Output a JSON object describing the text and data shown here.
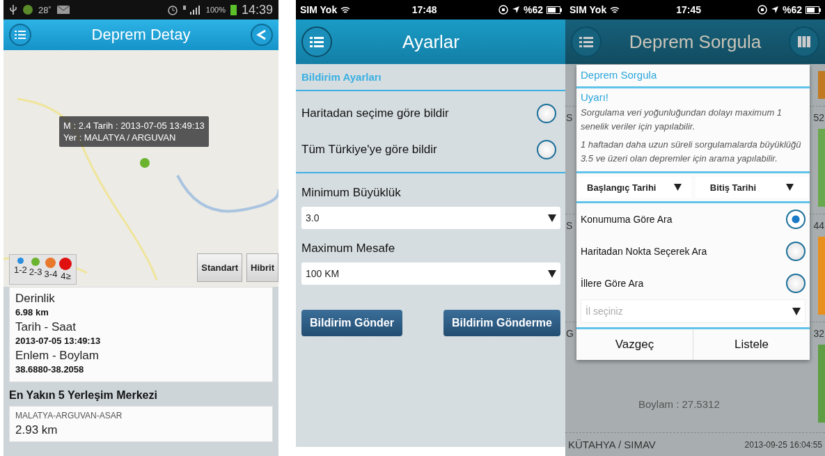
{
  "detail_screen": {
    "status_bar": {
      "temperature": "28˚",
      "battery": "100%",
      "time": "14:39"
    },
    "title": "Deprem Detay",
    "map": {
      "popup_lines": [
        "M : 2.4  Tarih : 2013-07-05 13:49:13",
        "Yer : MALATYA  / ARGUVAN"
      ],
      "legend": [
        {
          "label": "1-2",
          "color": "#2a8fe0"
        },
        {
          "label": "2-3",
          "color": "#6ab32e"
        },
        {
          "label": "3-4",
          "color": "#e8782a"
        },
        {
          "label": "4≥",
          "color": "#e01010"
        }
      ],
      "map_types": [
        "Standart",
        "Hibrit"
      ]
    },
    "details": [
      {
        "label": "Derinlik",
        "value": "6.98 km"
      },
      {
        "label": "Tarih - Saat",
        "value": "2013-07-05 13:49:13"
      },
      {
        "label": "Enlem - Boylam",
        "value": "38.6880-38.2058"
      }
    ],
    "nearest_title": "En Yakın 5 Yerleşim Merkezi",
    "nearest": [
      {
        "name": "MALATYA-ARGUVAN-ASAR",
        "distance": "2.93 km"
      }
    ]
  },
  "settings_screen": {
    "status_bar": {
      "carrier": "SIM Yok",
      "time": "17:48",
      "battery": "%62"
    },
    "title": "Ayarlar",
    "section": "Bildirim Ayarları",
    "options": [
      {
        "label": "Haritadan seçime göre bildir",
        "selected": false
      },
      {
        "label": "Tüm Türkiye'ye göre bildir",
        "selected": false
      }
    ],
    "fields": [
      {
        "label": "Minimum Büyüklük",
        "value": "3.0"
      },
      {
        "label": "Maximum Mesafe",
        "value": "100 KM"
      }
    ],
    "buttons": [
      "Bildirim Gönder",
      "Bildirim Gönderme"
    ]
  },
  "query_screen": {
    "status_bar": {
      "carrier": "SIM Yok",
      "time": "17:45",
      "battery": "%62"
    },
    "title": "Deprem Sorgula",
    "background": {
      "rows": [
        {
          "start": "S",
          "end": "52",
          "color": "#6aa84f"
        },
        {
          "start": "S",
          "end": "44",
          "color": "#e8901e"
        },
        {
          "start": "G",
          "end": "32",
          "color": "#5f9e45"
        }
      ],
      "coordinate": "Boylam  : 27.5312",
      "last_place": "KÜTAHYA / SIMAV",
      "last_time": "2013-09-25 16:04:55"
    },
    "dialog": {
      "title": "Deprem Sorgula",
      "warning_title": "Uyarı!",
      "notes": [
        "Sorgulama veri yoğunluğundan dolayı maximum 1 senelik veriler için yapılabilir.",
        "1 haftadan daha uzun süreli sorgulamalarda büyüklüğü 3.5 ve üzeri olan depremler için arama yapılabilir."
      ],
      "date_pickers": [
        "Başlangıç Tarihi",
        "Bitiş Tarihi"
      ],
      "options": [
        {
          "label": "Konumuma Göre Ara",
          "selected": true
        },
        {
          "label": "Haritadan Nokta Seçerek Ara",
          "selected": false
        },
        {
          "label": "İllere Göre Ara",
          "selected": false
        }
      ],
      "city_placeholder": "İl seçiniz",
      "buttons": [
        "Vazgeç",
        "Listele"
      ]
    }
  }
}
